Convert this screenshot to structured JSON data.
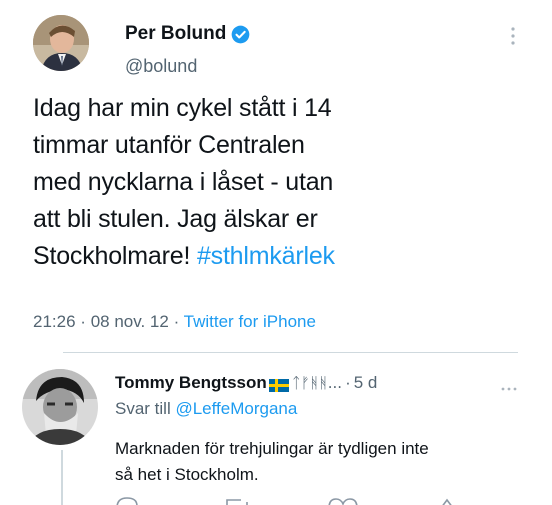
{
  "tweet": {
    "author_name": "Per Bolund",
    "handle": "@bolund",
    "text_lines": [
      "Idag har min cykel stått i 14",
      "timmar utanför Centralen",
      "med nycklarna i låset - utan",
      "att bli stulen. Jag älskar er",
      "Stockholmare! "
    ],
    "hashtag": "#sthlmkärlek",
    "time": "21:26",
    "date": "08 nov. 12",
    "source": "Twitter for iPhone",
    "separator": "·",
    "more_icon": "more-vertical-icon",
    "verified_icon": "verified-badge-icon",
    "accent_color": "#1d9bf0"
  },
  "reply": {
    "author_name": "Tommy Bengtsson",
    "name_suffix": "ᛏᚠᚻᚻ...",
    "flag": "🇸🇪",
    "age": "5 d",
    "separator": "·",
    "reply_to_label": "Svar till ",
    "reply_to_handle": "@LeffeMorgana",
    "text_lines": [
      "Marknaden för trehjulingar är tydligen inte",
      "så het i Stockholm."
    ],
    "more_icon": "more-horizontal-icon"
  }
}
